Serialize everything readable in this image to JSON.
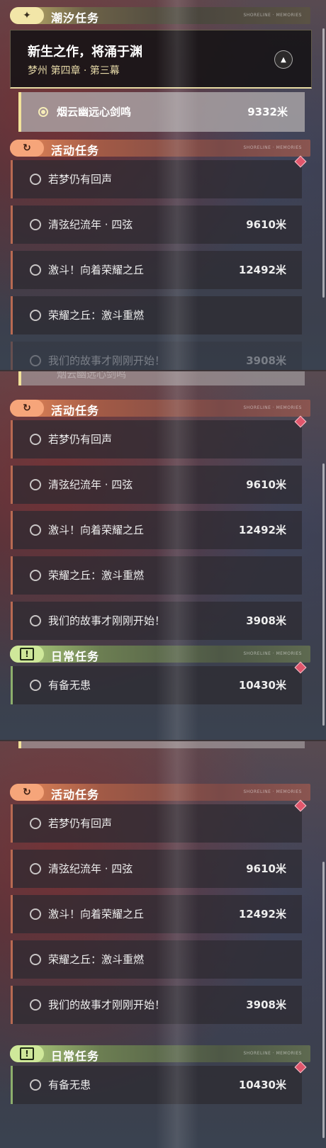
{
  "tide": {
    "header": "潮汐任务",
    "header_icon": "sparkle-icon",
    "deco_text": "SHORELINE · MEMORIES",
    "title": "新生之作，将涌于渊",
    "subtitle": "梦州 第四章 · 第三幕",
    "tracked": {
      "name": "烟云幽远心剑鸣",
      "distance": "9332米"
    }
  },
  "event": {
    "header": "活动任务",
    "header_icon": "refresh-icon",
    "deco_text": "SHORELINE · MEMORIES",
    "items": [
      {
        "name": "若梦仍有回声",
        "distance": ""
      },
      {
        "name": "清弦纪流年 · 四弦",
        "distance": "9610米"
      },
      {
        "name": "激斗！向着荣耀之丘",
        "distance": "12492米"
      },
      {
        "name": "荣耀之丘：激斗重燃",
        "distance": ""
      },
      {
        "name": "我们的故事才刚刚开始！",
        "distance": "3908米"
      }
    ]
  },
  "daily": {
    "header": "日常任务",
    "header_icon": "alert-icon",
    "icon_glyph": "!",
    "deco_text": "SHORELINE · MEMORIES",
    "items": [
      {
        "name": "有备无患",
        "distance": "10430米"
      }
    ]
  },
  "colors": {
    "tide_accent": "#e8dca4",
    "event_accent": "#e88a5a",
    "daily_accent": "#b6d682",
    "new_marker": "#e0566c"
  }
}
